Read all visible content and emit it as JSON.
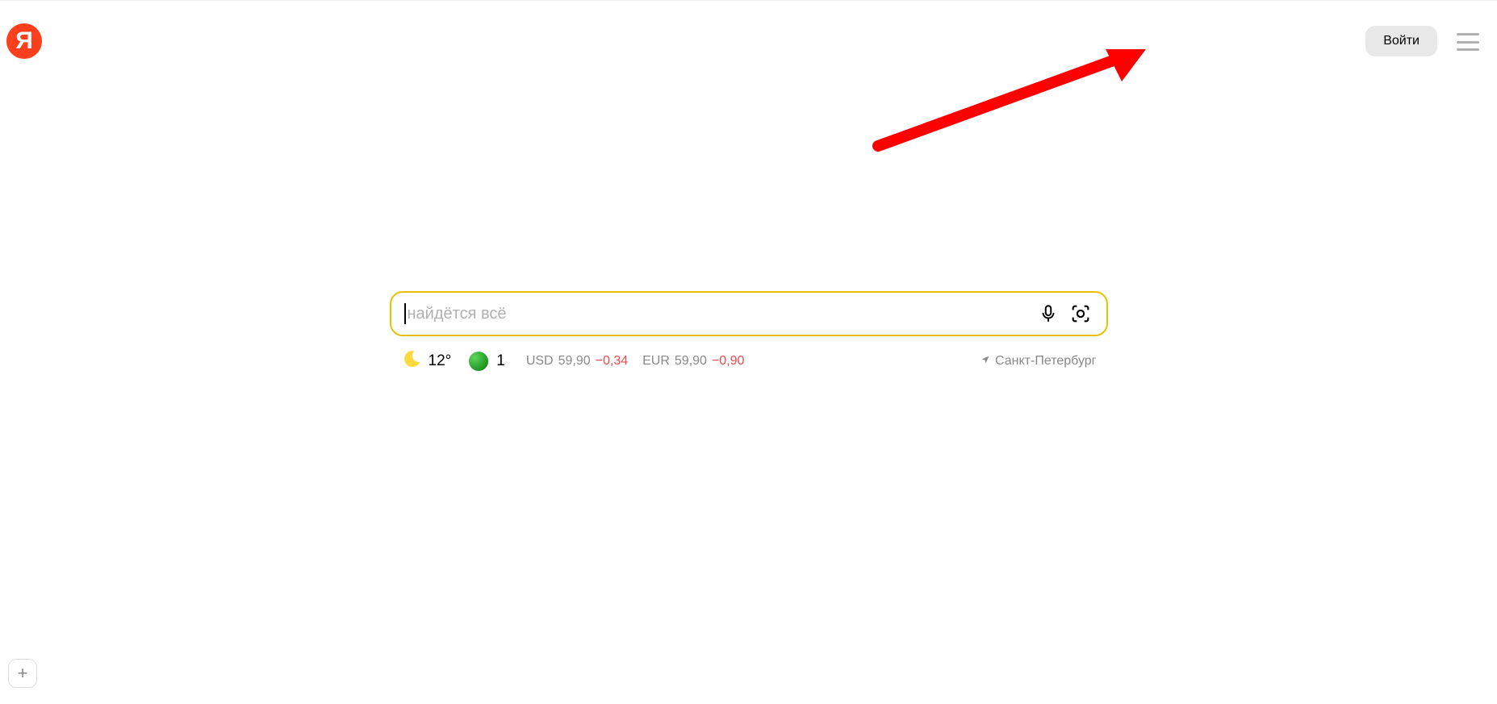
{
  "header": {
    "logo_letter": "Я",
    "login_label": "Войти"
  },
  "search": {
    "placeholder": "найдётся всё"
  },
  "info": {
    "weather": {
      "temperature": "12°"
    },
    "traffic": {
      "level": "1"
    },
    "currencies": [
      {
        "label": "USD",
        "value": "59,90",
        "delta": "−0,34"
      },
      {
        "label": "EUR",
        "value": "59,90",
        "delta": "−0,90"
      }
    ],
    "location": "Санкт-Петербург"
  },
  "add_button": "+"
}
